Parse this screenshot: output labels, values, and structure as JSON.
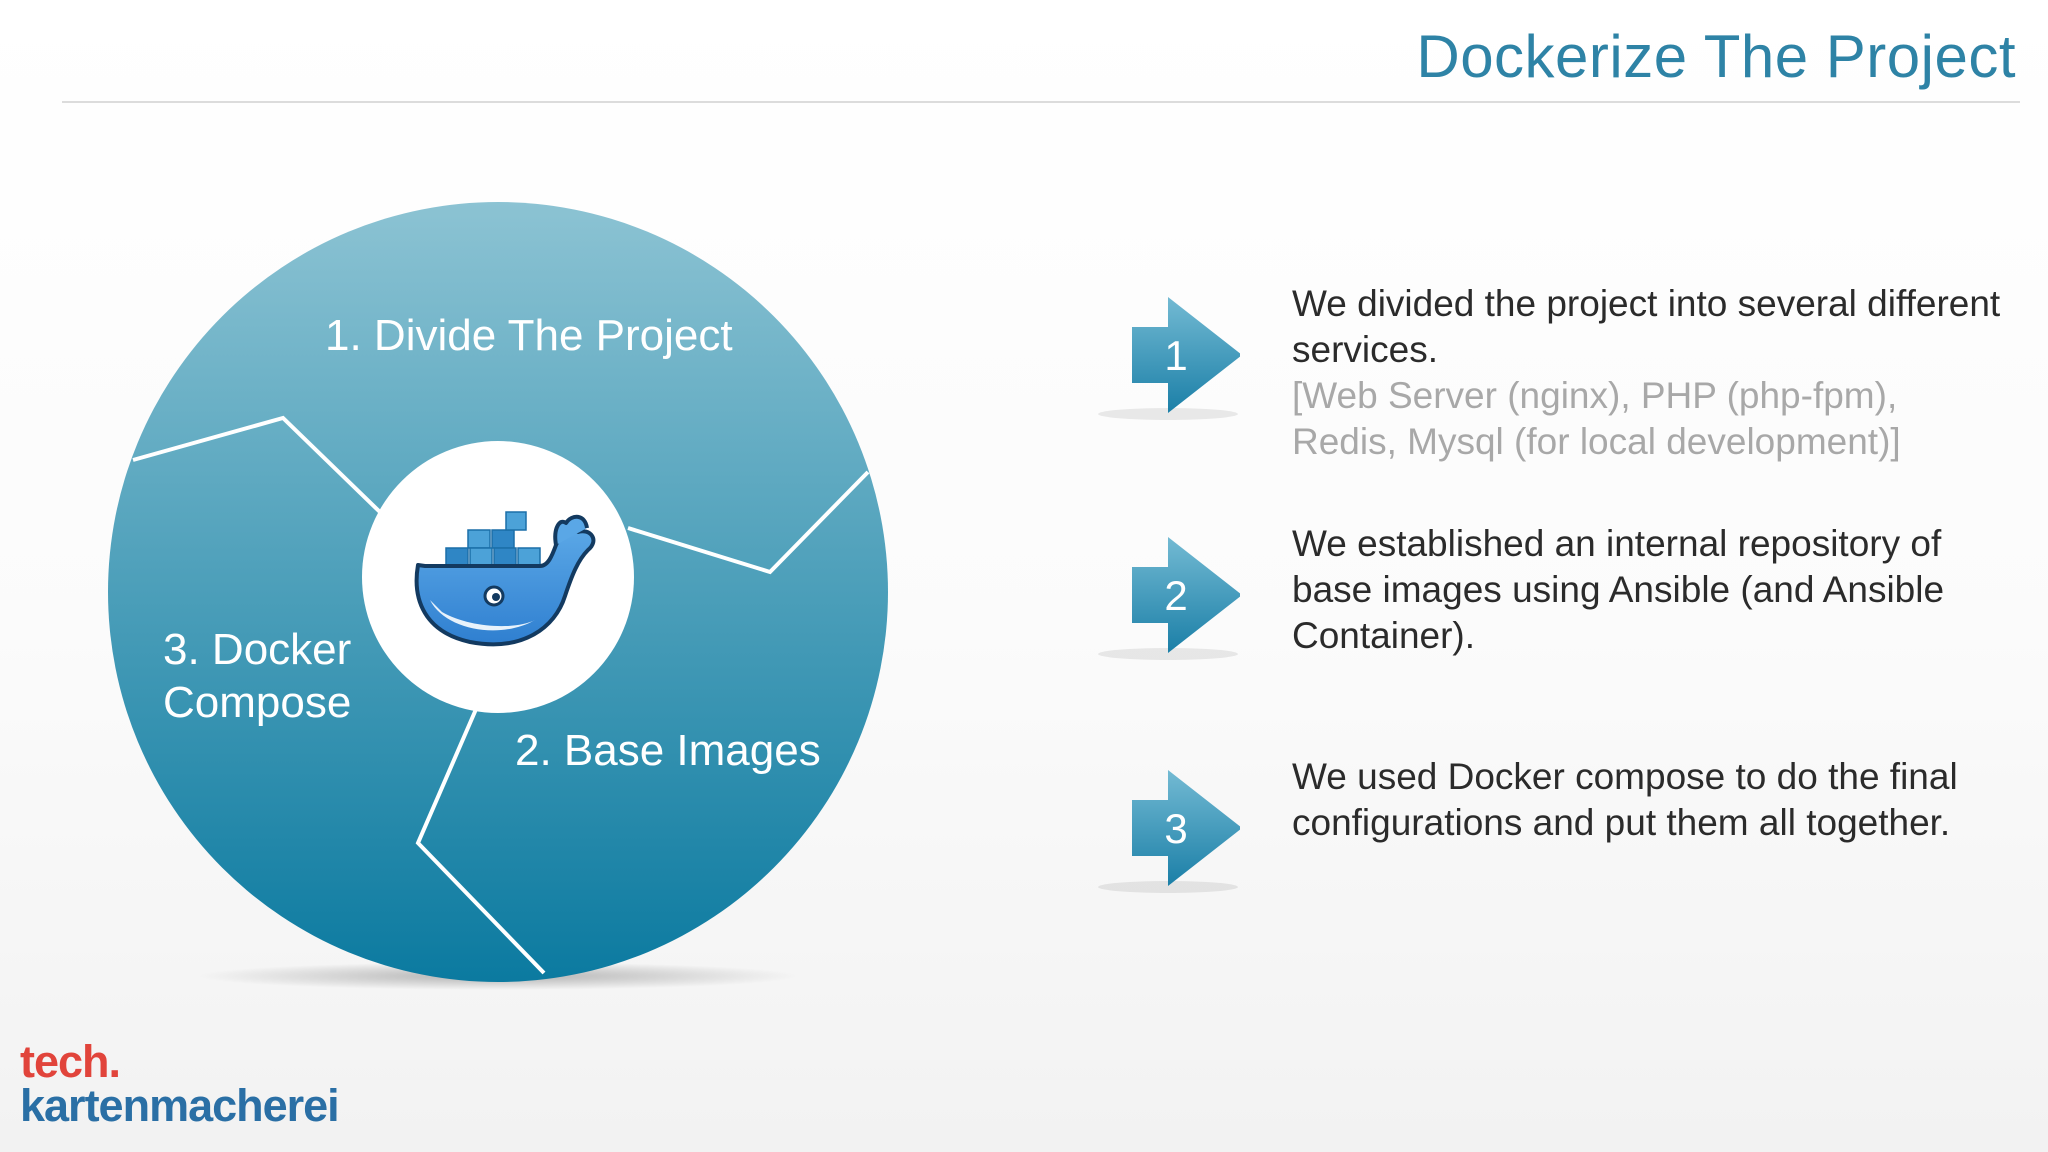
{
  "slide": {
    "title": "Dockerize The Project"
  },
  "cycle": {
    "segments": [
      {
        "label": "1. Divide The Project"
      },
      {
        "label": "2. Base Images"
      },
      {
        "label_line1": "3. Docker",
        "label_line2": "Compose"
      }
    ],
    "center_icon": "docker-whale-icon",
    "colors": {
      "disc_top": "#8cc3d3",
      "disc_bottom": "#0b7aa0",
      "divider": "#ffffff"
    }
  },
  "steps": [
    {
      "number": "1",
      "text": "We divided the project into several different services.",
      "note": "[Web Server (nginx), PHP (php-fpm), Redis, Mysql (for local development)]"
    },
    {
      "number": "2",
      "text": "We established an internal repository of base images using Ansible (and Ansible Container)."
    },
    {
      "number": "3",
      "text": "We used Docker compose to do the final configurations and put them all together."
    }
  ],
  "brand": {
    "line1": "tech.",
    "line2": "kartenmacherei",
    "colors": {
      "line1": "#e1443b",
      "line2": "#2a6fa5"
    }
  }
}
